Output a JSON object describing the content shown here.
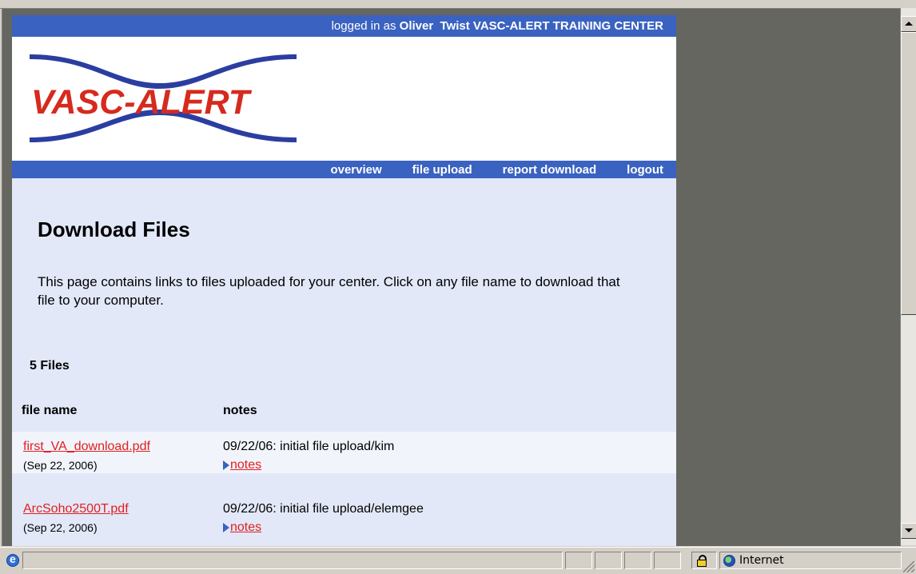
{
  "header": {
    "login_prefix": "logged in as ",
    "user_name": "Oliver  Twist",
    "center": " VASC-ALERT TRAINING CENTER"
  },
  "logo": {
    "text": "VASC-ALERT",
    "color": "#d62a1e",
    "wave_color": "#2b3ea0"
  },
  "nav": {
    "overview": "overview",
    "file_upload": "file upload",
    "report_download": "report download",
    "logout": "logout"
  },
  "main": {
    "title": "Download Files",
    "intro": "This page contains links to files uploaded for your center. Click on any file name to download that file to your computer.",
    "file_count": "5 Files",
    "col_file": "file name",
    "col_notes": "notes",
    "files": [
      {
        "name": "first_VA_download.pdf",
        "date": "(Sep 22, 2006)",
        "note": "09/22/06: initial file upload/kim",
        "notes_link": "notes"
      },
      {
        "name": "ArcSoho2500T.pdf",
        "date": "(Sep 22, 2006)",
        "note": "09/22/06: initial file upload/elemgee",
        "notes_link": "notes"
      }
    ]
  },
  "status": {
    "zone": "Internet"
  },
  "colors": {
    "blue_bar": "#3a62c0",
    "page_bg": "#e2e8f8",
    "link": "#e02020",
    "outer_bg": "#666660"
  }
}
